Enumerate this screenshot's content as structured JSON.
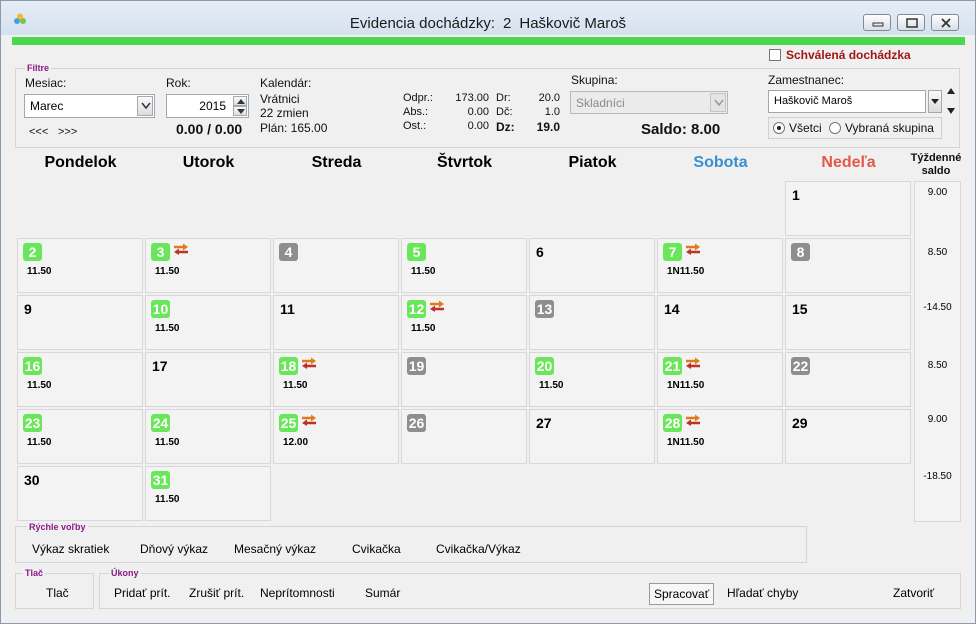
{
  "window": {
    "title_prefix": "Evidencia dochádzky:",
    "employee_id": "2",
    "employee_name": "Haškovič Maroš"
  },
  "approved_attendance_label": "Schválená dochádzka",
  "filters": {
    "legend": "Filtre",
    "month_label": "Mesiac:",
    "month_value": "Marec",
    "prev_label": "<<<",
    "next_label": ">>>",
    "year_label": "Rok:",
    "year_value": "2015",
    "balance": "0.00 / 0.00",
    "calendar_label": "Kalendár:",
    "calendar_lines": [
      "Vrátnici",
      "22 zmien",
      "Plán: 165.00"
    ],
    "stats": {
      "odpr_label": "Odpr.:",
      "odpr_value": "173.00",
      "abs_label": "Abs.:",
      "abs_value": "0.00",
      "ost_label": "Ost.:",
      "ost_value": "0.00",
      "dr_label": "Dr:",
      "dr_value": "20.0",
      "dc_label": "Dč:",
      "dc_value": "1.0",
      "dz_label": "Dz:",
      "dz_value": "19.0"
    },
    "group_label": "Skupina:",
    "group_value": "Skladníci",
    "saldo": "Saldo: 8.00",
    "employee_label": "Zamestnanec:",
    "employee_value": "Haškovič Maroš",
    "radio_all": "Všetci",
    "radio_group": "Vybraná skupina"
  },
  "calendar": {
    "day_names": [
      "Pondelok",
      "Utorok",
      "Streda",
      "Štvrtok",
      "Piatok",
      "Sobota",
      "Nedeľa"
    ],
    "weekly_header": "Týždenné saldo",
    "weekday_color": "#000000",
    "saturday_color": "#3a8fd0",
    "sunday_color": "#e05a4a",
    "weeks": [
      [
        null,
        null,
        null,
        null,
        null,
        null,
        {
          "day": "1",
          "style": "plain",
          "hours": ""
        }
      ],
      [
        {
          "day": "2",
          "style": "green",
          "hours": "11.50"
        },
        {
          "day": "3",
          "style": "green",
          "hours": "11.50",
          "swap": true
        },
        {
          "day": "4",
          "style": "gray",
          "hours": ""
        },
        {
          "day": "5",
          "style": "green",
          "hours": "11.50"
        },
        {
          "day": "6",
          "style": "plain",
          "hours": ""
        },
        {
          "day": "7",
          "style": "green",
          "hours": "1N11.50",
          "swap": true
        },
        {
          "day": "8",
          "style": "gray",
          "hours": ""
        }
      ],
      [
        {
          "day": "9",
          "style": "plain",
          "hours": ""
        },
        {
          "day": "10",
          "style": "green",
          "hours": "11.50"
        },
        {
          "day": "11",
          "style": "plain",
          "hours": ""
        },
        {
          "day": "12",
          "style": "green",
          "hours": "11.50",
          "swap": true
        },
        {
          "day": "13",
          "style": "gray",
          "hours": ""
        },
        {
          "day": "14",
          "style": "plain",
          "hours": ""
        },
        {
          "day": "15",
          "style": "plain",
          "hours": ""
        }
      ],
      [
        {
          "day": "16",
          "style": "green",
          "hours": "11.50"
        },
        {
          "day": "17",
          "style": "plain",
          "hours": ""
        },
        {
          "day": "18",
          "style": "green",
          "hours": "11.50",
          "swap": true
        },
        {
          "day": "19",
          "style": "gray",
          "hours": ""
        },
        {
          "day": "20",
          "style": "green",
          "hours": "11.50"
        },
        {
          "day": "21",
          "style": "green",
          "hours": "1N11.50",
          "swap": true
        },
        {
          "day": "22",
          "style": "gray",
          "hours": ""
        }
      ],
      [
        {
          "day": "23",
          "style": "green",
          "hours": "11.50"
        },
        {
          "day": "24",
          "style": "green",
          "hours": "11.50"
        },
        {
          "day": "25",
          "style": "green",
          "hours": "12.00",
          "swap": true
        },
        {
          "day": "26",
          "style": "gray",
          "hours": ""
        },
        {
          "day": "27",
          "style": "plain",
          "hours": ""
        },
        {
          "day": "28",
          "style": "green",
          "hours": "1N11.50",
          "swap": true
        },
        {
          "day": "29",
          "style": "plain",
          "hours": ""
        }
      ],
      [
        {
          "day": "30",
          "style": "plain",
          "hours": ""
        },
        {
          "day": "31",
          "style": "green",
          "hours": "11.50"
        },
        null,
        null,
        null,
        null,
        null
      ]
    ],
    "weekly_saldo": [
      "9.00",
      "8.50",
      "-14.50",
      "8.50",
      "9.00",
      "-18.50"
    ]
  },
  "quick": {
    "legend": "Rýchle voľby",
    "items": [
      "Výkaz skratiek",
      "Dňový výkaz",
      "Mesačný výkaz",
      "Cvikačka",
      "Cvikačka/Výkaz"
    ]
  },
  "print": {
    "legend": "Tlač",
    "button": "Tlač"
  },
  "tasks": {
    "legend": "Úkony",
    "items": [
      "Pridať prít.",
      "Zrušiť prít.",
      "Neprítomnosti",
      "Sumár"
    ],
    "process": "Spracovať",
    "find_errors": "Hľadať chyby",
    "close": "Zatvoriť"
  }
}
